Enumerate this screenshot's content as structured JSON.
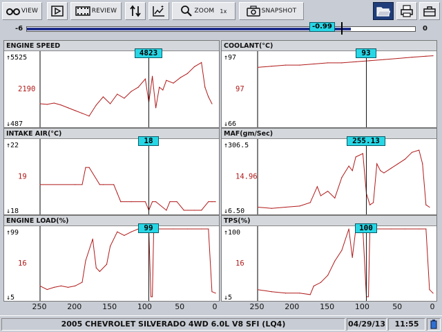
{
  "toolbar": {
    "view_label": "VIEW",
    "review_label": "REVIEW",
    "zoom_label": "ZOOM",
    "zoom_value": "1x",
    "snapshot_label": "SNAPSHOT"
  },
  "slider": {
    "min": "-6",
    "max": "0",
    "value": "-0.99",
    "fraction": 0.835
  },
  "x_ticks": [
    "250",
    "200",
    "150",
    "100",
    "50",
    "0"
  ],
  "panels": [
    {
      "title": "ENGINE SPEED",
      "max": "5525",
      "mid": "2190",
      "min": "487",
      "cursor": "4823",
      "color": "#b01818"
    },
    {
      "title": "COOLANT(°C)",
      "max": "97",
      "mid": "97",
      "min": "66",
      "cursor": "93",
      "color": "#b01818"
    },
    {
      "title": "INTAKE AIR(°C)",
      "max": "22",
      "mid": "19",
      "min": "18",
      "cursor": "18",
      "color": "#b01818"
    },
    {
      "title": "MAF(gm/Sec)",
      "max": "306.5",
      "mid": "14.96",
      "min": "6.50",
      "cursor": "255.13",
      "color": "#b01818"
    },
    {
      "title": "ENGINE LOAD(%)",
      "max": "99",
      "mid": "16",
      "min": "5",
      "cursor": "99",
      "color": "#b01818"
    },
    {
      "title": "TPS(%)",
      "max": "100",
      "mid": "16",
      "min": "5",
      "cursor": "100",
      "color": "#b01818"
    }
  ],
  "chart_data": [
    {
      "type": "line",
      "title": "ENGINE SPEED",
      "xlabel": "",
      "ylabel": "",
      "xlim": [
        250,
        0
      ],
      "ylim": [
        487,
        5525
      ],
      "x": [
        250,
        240,
        230,
        220,
        210,
        200,
        190,
        180,
        170,
        160,
        150,
        140,
        130,
        120,
        110,
        100,
        95,
        90,
        85,
        80,
        75,
        70,
        60,
        50,
        40,
        30,
        20,
        15,
        10,
        5
      ],
      "values": [
        1900,
        1850,
        1950,
        1800,
        1600,
        1400,
        1200,
        1000,
        1800,
        2400,
        1900,
        2600,
        2300,
        2800,
        3100,
        3700,
        2000,
        3900,
        1600,
        3100,
        2900,
        3600,
        3400,
        3800,
        4100,
        4600,
        4900,
        3100,
        2400,
        1900
      ]
    },
    {
      "type": "line",
      "title": "COOLANT(°C)",
      "xlabel": "",
      "ylabel": "",
      "xlim": [
        250,
        0
      ],
      "ylim": [
        66,
        97
      ],
      "x": [
        250,
        230,
        210,
        190,
        170,
        150,
        130,
        110,
        90,
        70,
        50,
        30,
        10,
        0
      ],
      "values": [
        91,
        91.5,
        92,
        92,
        92.5,
        93,
        93,
        93.5,
        94,
        94.5,
        95,
        95.5,
        96,
        96.2
      ]
    },
    {
      "type": "line",
      "title": "INTAKE AIR(°C)",
      "xlabel": "",
      "ylabel": "",
      "xlim": [
        250,
        0
      ],
      "ylim": [
        18,
        22
      ],
      "x": [
        250,
        200,
        190,
        185,
        180,
        165,
        160,
        145,
        140,
        135,
        120,
        100,
        95,
        90,
        85,
        70,
        65,
        55,
        45,
        30,
        20,
        10,
        5,
        0
      ],
      "values": [
        19.5,
        19.5,
        19.5,
        20.5,
        20.5,
        19.5,
        19.5,
        19.5,
        19,
        18.5,
        18.5,
        18.5,
        18,
        18.5,
        18.5,
        18,
        18.5,
        18.5,
        18,
        18,
        18,
        18.5,
        18.5,
        18.5
      ]
    },
    {
      "type": "line",
      "title": "MAF(gm/Sec)",
      "xlabel": "",
      "ylabel": "",
      "xlim": [
        250,
        0
      ],
      "ylim": [
        6.5,
        306.5
      ],
      "x": [
        250,
        230,
        210,
        190,
        175,
        165,
        160,
        150,
        140,
        130,
        120,
        115,
        110,
        100,
        95,
        90,
        85,
        80,
        75,
        70,
        60,
        50,
        40,
        30,
        20,
        15,
        10,
        5
      ],
      "values": [
        20,
        15,
        20,
        25,
        40,
        110,
        70,
        90,
        60,
        150,
        200,
        180,
        240,
        255,
        80,
        30,
        40,
        210,
        180,
        170,
        190,
        210,
        230,
        260,
        270,
        210,
        30,
        20
      ]
    },
    {
      "type": "line",
      "title": "ENGINE LOAD(%)",
      "xlabel": "",
      "ylabel": "",
      "xlim": [
        250,
        0
      ],
      "ylim": [
        5,
        99
      ],
      "x": [
        250,
        240,
        230,
        220,
        210,
        200,
        190,
        185,
        175,
        170,
        165,
        155,
        150,
        140,
        130,
        120,
        110,
        100,
        95,
        92,
        90,
        88,
        85,
        60,
        40,
        20,
        10,
        5,
        0
      ],
      "values": [
        20,
        15,
        18,
        20,
        18,
        20,
        25,
        55,
        85,
        45,
        40,
        50,
        75,
        95,
        90,
        95,
        99,
        99,
        99,
        5,
        5,
        99,
        99,
        99,
        99,
        99,
        99,
        12,
        10
      ]
    },
    {
      "type": "line",
      "title": "TPS(%)",
      "xlabel": "",
      "ylabel": "",
      "xlim": [
        250,
        0
      ],
      "ylim": [
        5,
        100
      ],
      "x": [
        250,
        230,
        210,
        190,
        175,
        170,
        160,
        150,
        140,
        130,
        120,
        115,
        110,
        100,
        95,
        92,
        90,
        85,
        60,
        40,
        20,
        10,
        5,
        0
      ],
      "values": [
        15,
        12,
        10,
        10,
        8,
        20,
        25,
        35,
        55,
        70,
        100,
        60,
        100,
        100,
        5,
        5,
        100,
        100,
        100,
        100,
        100,
        100,
        15,
        10
      ]
    }
  ],
  "status": {
    "vehicle": "2005 CHEVROLET SILVERADO 4WD 6.0L V8 SFI (LQ4)",
    "date": "04/29/13",
    "time": "11:55"
  }
}
